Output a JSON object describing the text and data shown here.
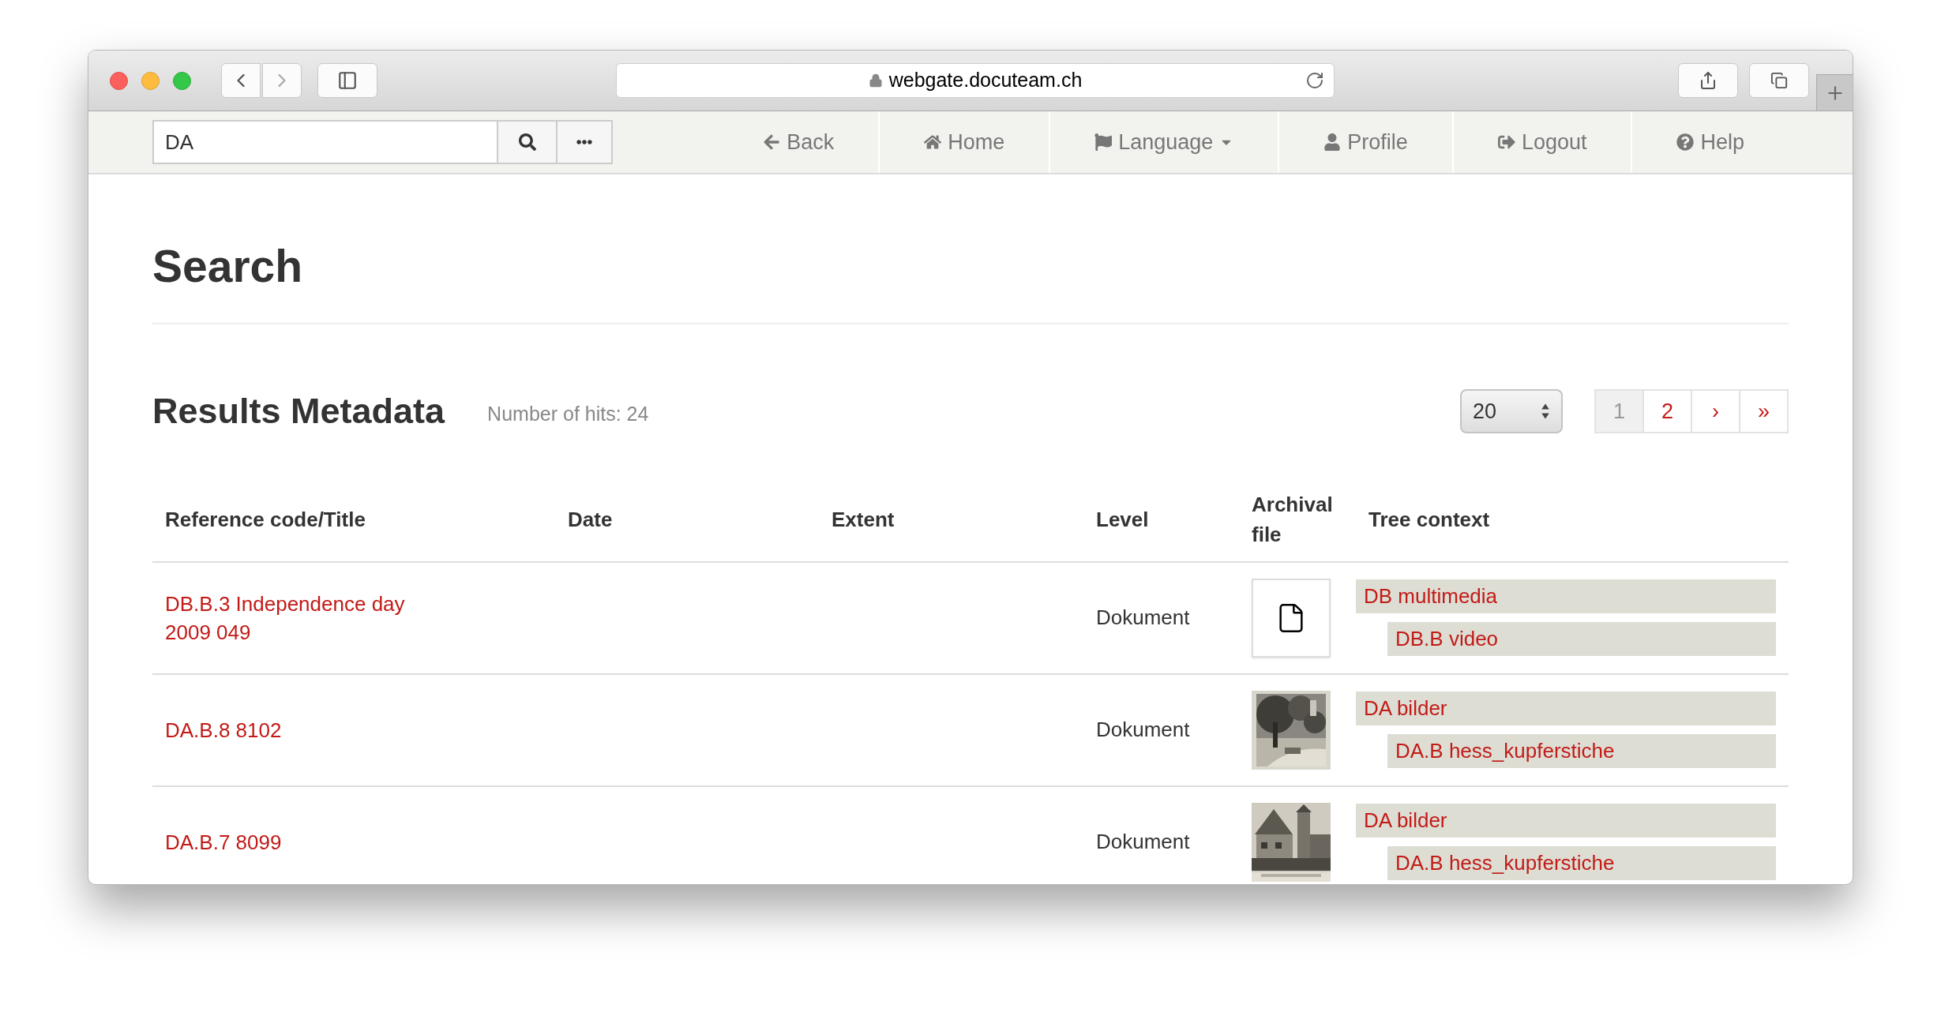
{
  "browser": {
    "url": "webgate.docuteam.ch"
  },
  "navbar": {
    "search": {
      "value": "DA"
    },
    "items": [
      {
        "label": "Back",
        "kind": "back"
      },
      {
        "label": "Home",
        "kind": "home"
      },
      {
        "label": "Language",
        "kind": "language"
      },
      {
        "label": "Profile",
        "kind": "profile"
      },
      {
        "label": "Logout",
        "kind": "logout"
      },
      {
        "label": "Help",
        "kind": "help"
      }
    ]
  },
  "page": {
    "title": "Search"
  },
  "results": {
    "title": "Results Metadata",
    "hits": "Number of hits: 24",
    "page_size": "20",
    "pages": [
      {
        "label": "1",
        "selected": true
      },
      {
        "label": "2",
        "selected": false
      },
      {
        "label": "›",
        "selected": false
      },
      {
        "label": "»",
        "selected": false
      }
    ]
  },
  "table": {
    "columns": [
      "Reference code/Title",
      "Date",
      "Extent",
      "Level",
      "Archival file",
      "Tree context"
    ],
    "rows": [
      {
        "title": "DB.B.3 Independence day 2009 049",
        "level": "Dokument",
        "file": {
          "kind": "document"
        },
        "tree": {
          "label": "DB multimedia",
          "children": [
            {
              "label": "DB.B video"
            }
          ]
        }
      },
      {
        "title": "DA.B.8 8102",
        "level": "Dokument",
        "file": {
          "kind": "park"
        },
        "tree": {
          "label": "DA bilder",
          "children": [
            {
              "label": "DA.B hess_kupferstiche"
            }
          ]
        }
      },
      {
        "title": "DA.B.7 8099",
        "level": "Dokument",
        "file": {
          "kind": "house"
        },
        "tree": {
          "label": "DA bilder",
          "children": [
            {
              "label": "DA.B hess_kupferstiche"
            }
          ]
        }
      }
    ]
  }
}
